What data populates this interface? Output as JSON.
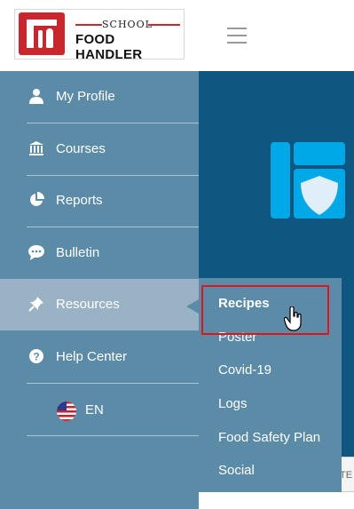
{
  "brand": {
    "top": "SCHOOL",
    "bottom": "FOOD HANDLER",
    "accent": "#c9272e"
  },
  "sidebar": {
    "items": [
      {
        "label": "My Profile",
        "icon": "user-icon"
      },
      {
        "label": "Courses",
        "icon": "bank-icon"
      },
      {
        "label": "Reports",
        "icon": "pie-chart-icon"
      },
      {
        "label": "Bulletin",
        "icon": "chat-bubble-icon"
      },
      {
        "label": "Resources",
        "icon": "pushpin-icon",
        "active": true
      },
      {
        "label": "Help Center",
        "icon": "question-circle-icon"
      }
    ],
    "language": {
      "label": "EN",
      "icon": "us-flag-icon"
    }
  },
  "submenu": {
    "items": [
      "Recipes",
      "Poster",
      "Covid-19",
      "Logs",
      "Food Safety Plan",
      "Social"
    ],
    "highlighted": "Recipes"
  },
  "main": {
    "strip_text": "TE"
  },
  "colors": {
    "sidebar": "#5c8ba8",
    "active_item": "#9ab3c4",
    "main_bg": "#0f5680",
    "highlight_border": "#e0151a"
  }
}
